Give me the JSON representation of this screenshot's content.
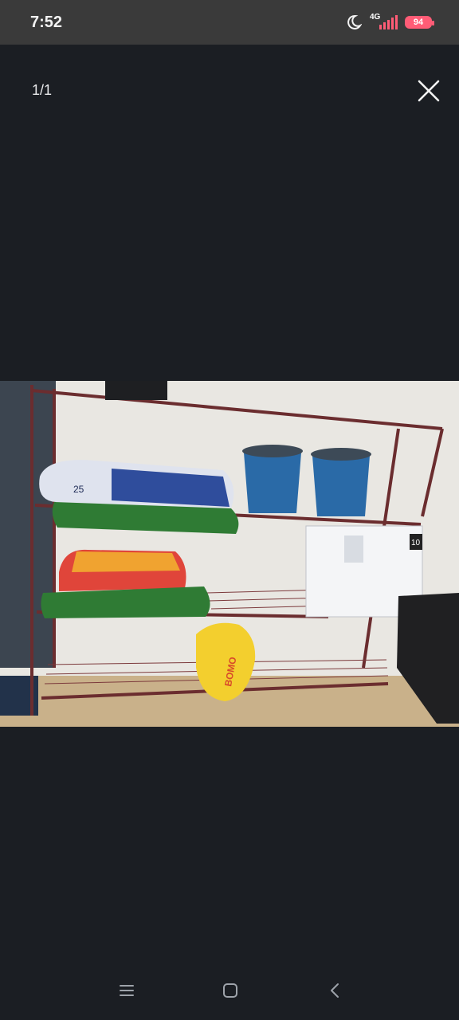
{
  "status_bar": {
    "time": "7:52",
    "network": "4G",
    "battery": "94",
    "icons": [
      "moon-icon",
      "signal-icon",
      "battery-icon"
    ],
    "accent": "#ff5c76"
  },
  "viewer": {
    "counter": "1/1",
    "close_icon": "close-icon"
  },
  "photo": {
    "description_icon": "photo",
    "bag_label_left_top": "25",
    "bag_label_bottom": "BOMO",
    "fridge_badge": "10"
  },
  "nav_bar": {
    "items": [
      "menu-icon",
      "home-icon",
      "back-icon"
    ]
  }
}
